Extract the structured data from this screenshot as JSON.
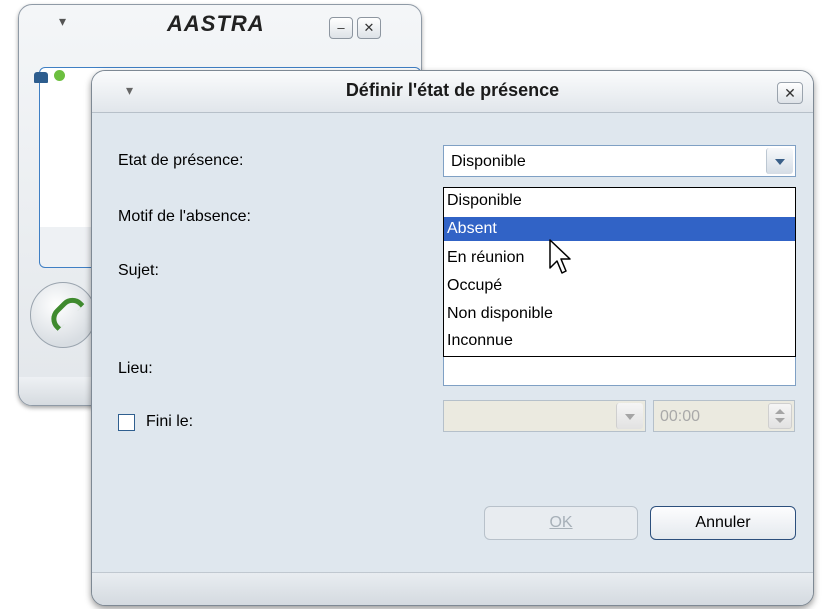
{
  "background_window": {
    "logo": "AASTRA",
    "menu_glyph": "▾",
    "minimize_glyph": "–",
    "close_glyph": "✕"
  },
  "dialog": {
    "title": "Définir l'état de présence",
    "menu_glyph": "▾",
    "close_glyph": "✕",
    "fields": {
      "presence_label": "Etat de présence:",
      "presence_value": "Disponible",
      "absence_reason_label": "Motif de l'absence:",
      "subject_label": "Sujet:",
      "location_label": "Lieu:",
      "finished_label": "Fini le:",
      "finished_checked": false,
      "time_value": "00:00"
    },
    "dropdown": {
      "open": true,
      "options": [
        "Disponible",
        "Absent",
        "En réunion",
        "Occupé",
        "Non disponible",
        "Inconnue"
      ],
      "highlighted_index": 1
    },
    "buttons": {
      "ok_label": "OK",
      "ok_enabled": false,
      "cancel_label": "Annuler"
    }
  },
  "colors": {
    "dialog_background": "#dfe7ee",
    "selection": "#3163c6",
    "accent_border": "#3f7fc4"
  }
}
